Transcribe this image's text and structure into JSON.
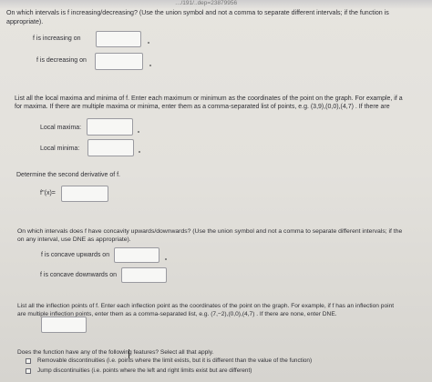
{
  "top_fragment": "…/191/..dep=23879956",
  "q1": {
    "prompt_line1": "On which intervals is f increasing/decreasing? (Use the union symbol and not a comma to separate different intervals; if the function is",
    "prompt_line2": "appropriate).",
    "increasing_label": "f is increasing on",
    "decreasing_label": "f is decreasing on",
    "increasing_value": "",
    "decreasing_value": ""
  },
  "q2": {
    "prompt_line1": "List all the local maxima and minima of f. Enter each maximum or minimum as the coordinates of the point on the graph. For example, if a",
    "prompt_line2": "for maxima. If there are multiple maxima or minima, enter them as a comma-separated list of points, e.g. (3,9),(0,0),(4,7) . If there are",
    "max_label": "Local maxima:",
    "min_label": "Local minima:",
    "max_value": "",
    "min_value": ""
  },
  "q3": {
    "prompt": "Determine the second derivative of f.",
    "label": "f''(x)=",
    "value": ""
  },
  "q4": {
    "prompt_line1": "On which intervals does f have concavity upwards/downwards? (Use the union symbol and not a comma to separate different intervals; if the",
    "prompt_line2": "on any interval, use DNE as appropriate).",
    "up_label": "f is concave upwards on",
    "down_label": "f is concave downwards on",
    "up_value": "",
    "down_value": ""
  },
  "q5": {
    "prompt_line1": "List all the inflection points of f. Enter each inflection point as the coordinates of the point on the graph. For example, if f has an inflection point",
    "prompt_line2": "are multiple inflection points, enter them as a comma-separated list, e.g. (7,−2),(0,0),(4,7) . If there are none, enter DNE.",
    "value": ""
  },
  "q6": {
    "prompt": "Does the function have any of the following features? Select all that apply.",
    "options": [
      "Removable discontinuities (i.e. points where the limit exists, but it is different than the value of the function)",
      "Jump discontinuities (i.e. points where the left and right limits exist but are different)"
    ]
  }
}
